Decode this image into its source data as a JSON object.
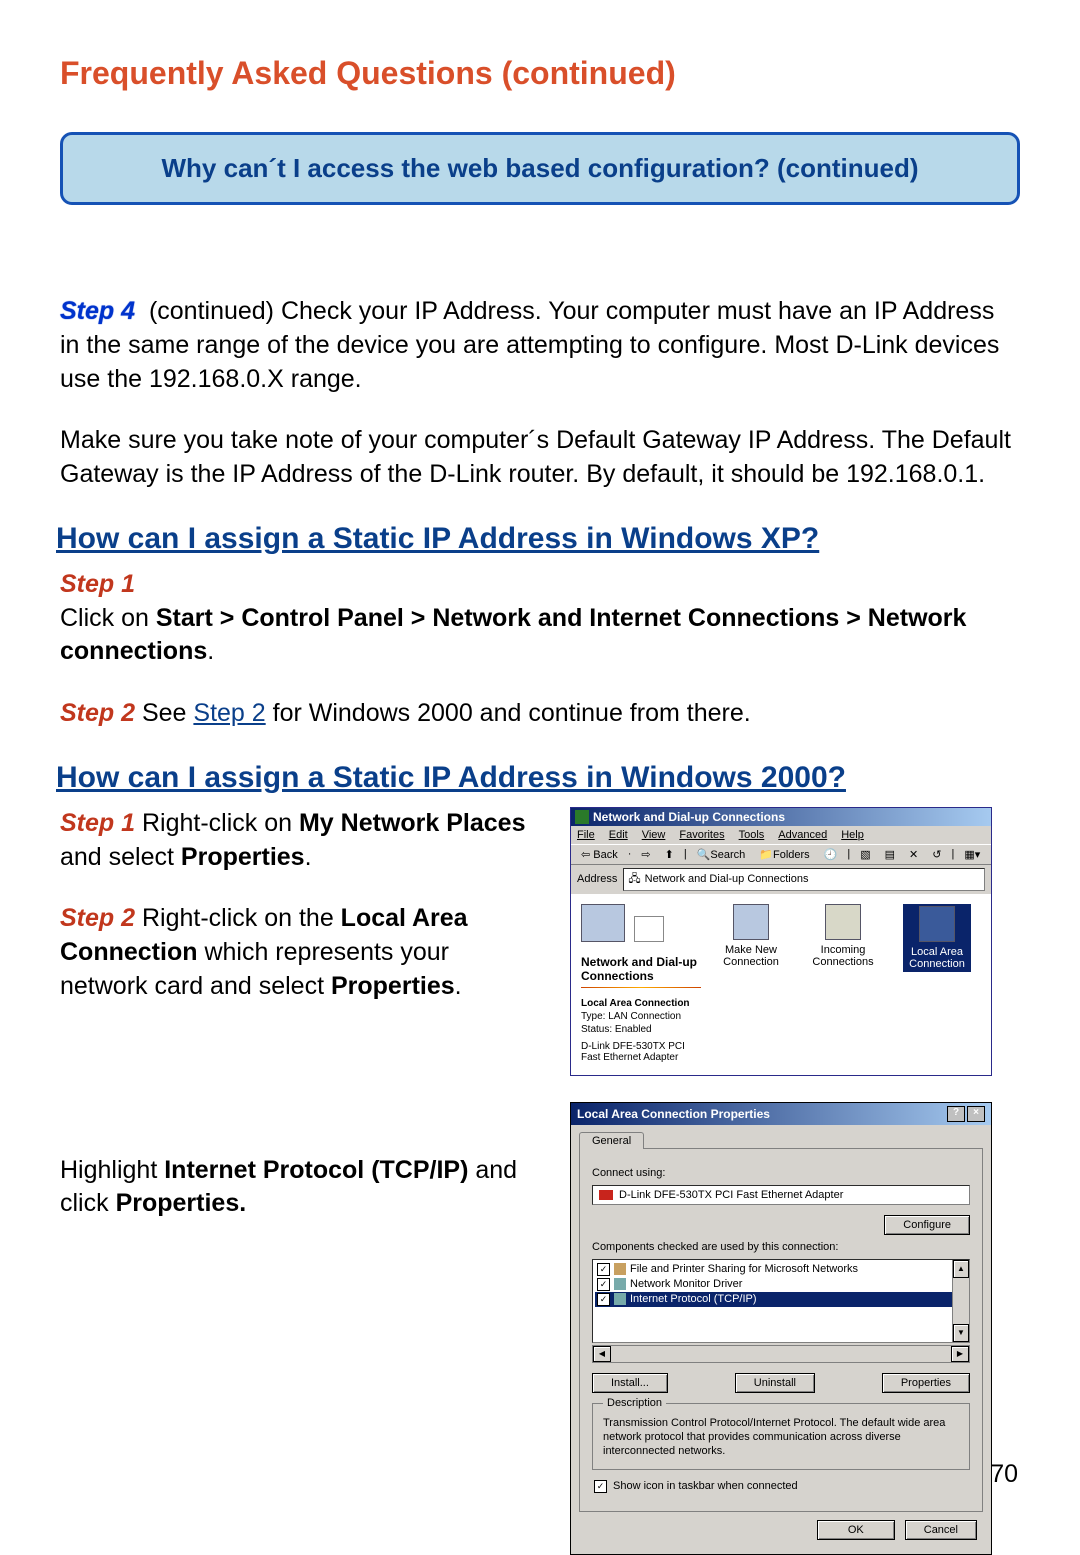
{
  "page": {
    "title": "Frequently Asked Questions (continued)",
    "subTitle": "Why can´t I access the web based configuration? (continued)",
    "pageNumber": "70"
  },
  "intro": {
    "step4Label": "Step 4",
    "step4Cont": "(continued) Check your IP Address. Your computer must have an IP Address in the same range of the device you are attempting to configure. Most D-Link devices use the 192.168.0.X range.",
    "para2": "Make sure you take note of your computer´s Default Gateway IP Address. The Default Gateway is the IP Address of the D-Link router. By default, it should be 192.168.0.1."
  },
  "xp": {
    "heading": "How can I assign a Static IP Address in Windows XP?",
    "step1Label": "Step 1",
    "step1TextA": "Click on ",
    "step1Bold": "Start > Control Panel > Network and Internet Connections > Network connections",
    "step1Tail": ".",
    "step2Label": "Step 2",
    "step2TextA": " See ",
    "step2Link": "Step 2",
    "step2TextB": " for Windows 2000 and continue from there."
  },
  "w2k": {
    "heading": "How can I assign a Static IP Address in Windows 2000?",
    "s1Label": "Step 1",
    "s1a": " Right-click on ",
    "s1b": "My Network Places",
    "s1c": " and select ",
    "s1d": "Properties",
    "s1e": ".",
    "s2Label": "Step 2",
    "s2a": " Right-click on the ",
    "s2b": "Local Area Connection",
    "s2c": " which represents your network card and select ",
    "s2d": "Properties",
    "s2e": ".",
    "s3a": "Highlight ",
    "s3b": "Internet Protocol (TCP/IP)",
    "s3c": " and click ",
    "s3d": "Properties."
  },
  "shot1": {
    "title": "Network and Dial-up Connections",
    "menu": {
      "file": "File",
      "edit": "Edit",
      "view": "View",
      "fav": "Favorites",
      "tools": "Tools",
      "adv": "Advanced",
      "help": "Help"
    },
    "toolbar": {
      "back": "Back",
      "search": "Search",
      "folders": "Folders",
      "history": ""
    },
    "addrLabel": "Address",
    "addrValue": "Network and Dial-up Connections",
    "icons": {
      "makeNew": "Make New Connection",
      "incoming": "Incoming Connections",
      "local": "Local Area Connection"
    },
    "panelTitle": "Network and Dial-up Connections",
    "lacHeading": "Local Area Connection",
    "type": "Type: LAN Connection",
    "status": "Status: Enabled",
    "adapterDesc": "D-Link DFE-530TX PCI Fast Ethernet Adapter"
  },
  "dlg": {
    "title": "Local Area Connection Properties",
    "tab": "General",
    "connectUsing": "Connect using:",
    "adapter": "D-Link DFE-530TX PCI Fast Ethernet Adapter",
    "configure": "Configure",
    "componentsLabel": "Components checked are used by this connection:",
    "item1": "File and Printer Sharing for Microsoft Networks",
    "item2": "Network Monitor Driver",
    "item3": "Internet Protocol (TCP/IP)",
    "install": "Install...",
    "uninstall": "Uninstall",
    "properties": "Properties",
    "descLegend": "Description",
    "desc": "Transmission Control Protocol/Internet Protocol. The default wide area network protocol that provides communication across diverse interconnected networks.",
    "showIcon": "Show icon in taskbar when connected",
    "ok": "OK",
    "cancel": "Cancel"
  }
}
